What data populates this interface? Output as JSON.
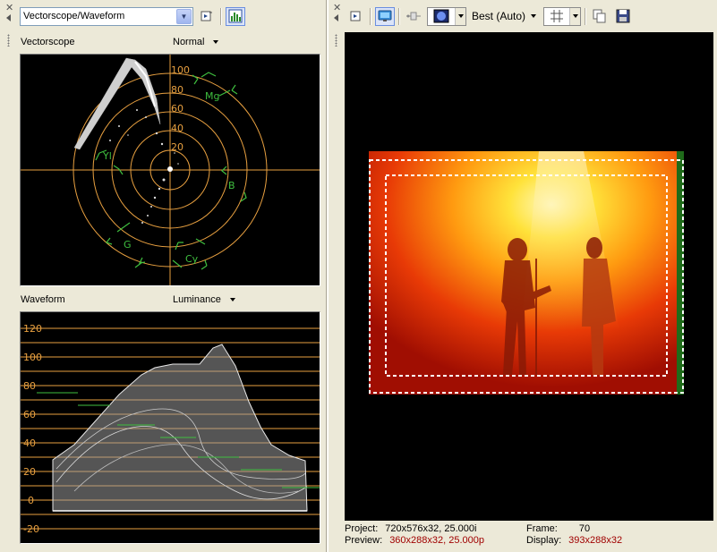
{
  "left": {
    "scope_select": "Vectorscope/Waveform",
    "vectorscope": {
      "label": "Vectorscope",
      "mode": "Normal",
      "rings": [
        "100",
        "80",
        "60",
        "40",
        "20"
      ],
      "targets": [
        "Mg",
        "Yl",
        "B",
        "G",
        "Cy"
      ]
    },
    "waveform": {
      "label": "Waveform",
      "mode": "Luminance",
      "levels": [
        "120",
        "100",
        "80",
        "60",
        "40",
        "20",
        "0",
        "-20"
      ]
    }
  },
  "right": {
    "quality": "Best (Auto)",
    "status": {
      "project_label": "Project:",
      "project_value": "720x576x32, 25.000i",
      "preview_label": "Preview:",
      "preview_value": "360x288x32, 25.000p",
      "frame_label": "Frame:",
      "frame_value": "70",
      "display_label": "Display:",
      "display_value": "393x288x32"
    }
  },
  "colors": {
    "scope_orange": "#e8a040",
    "target_green": "#3fbf3f",
    "status_red": "#a00000",
    "panel_bg": "#ece9d8"
  },
  "icons": [
    "close-icon",
    "pin-icon",
    "video-scope-icon",
    "histogram-icon",
    "select-icon",
    "monitor-icon",
    "split-screen-icon",
    "overlay-icon",
    "grid-icon",
    "copy-icon",
    "save-icon"
  ]
}
